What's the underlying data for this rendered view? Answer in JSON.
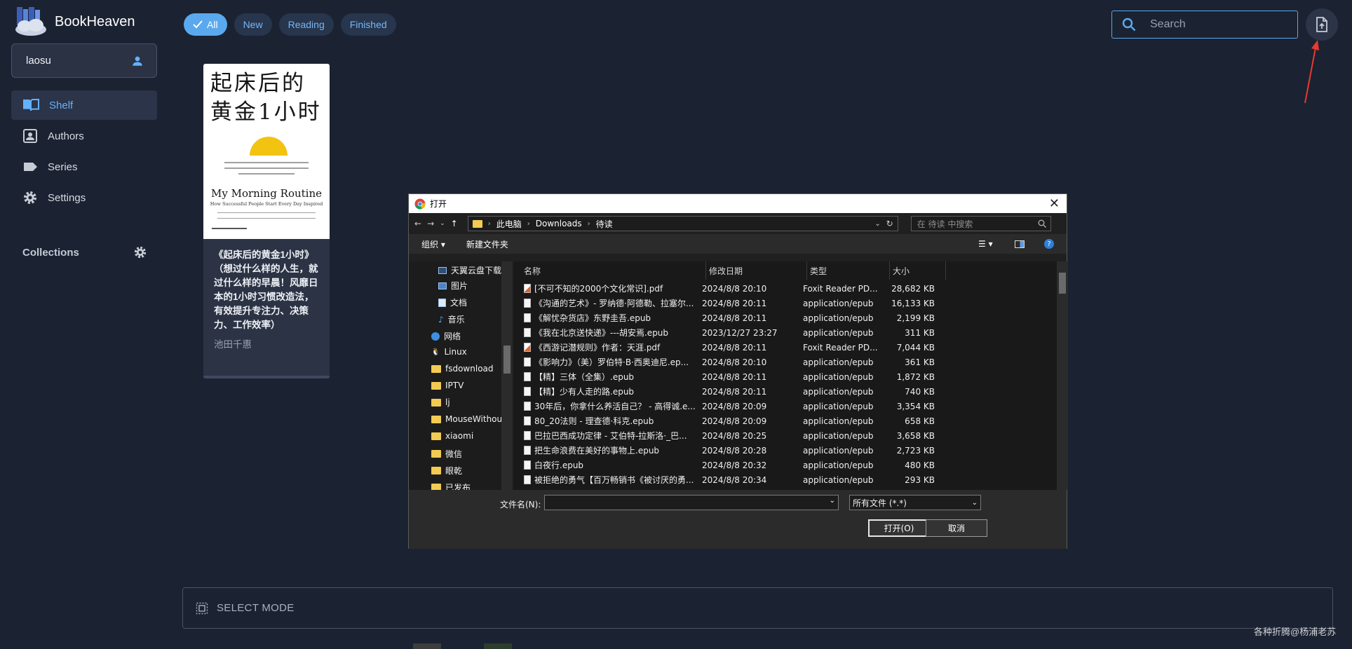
{
  "app": {
    "name": "BookHeaven",
    "user": "laosu",
    "nav": [
      {
        "label": "Shelf",
        "icon": "book-open-icon"
      },
      {
        "label": "Authors",
        "icon": "person-card-icon"
      },
      {
        "label": "Series",
        "icon": "tag-icon"
      },
      {
        "label": "Settings",
        "icon": "gear-icon"
      }
    ],
    "collections_label": "Collections",
    "filters": [
      "All",
      "New",
      "Reading",
      "Finished"
    ],
    "search_placeholder": "Search",
    "select_mode_label": "SELECT MODE",
    "watermark": "各种折腾@杨浦老苏",
    "accent": "#5aa9ee"
  },
  "book": {
    "cover_title": "起床后的黄金1小时",
    "cover_en": "My Morning Routine",
    "cover_en_sub": "How Successful People Start Every Day Inspired",
    "title": "《起床后的黄金1小时》（想过什么样的人生，就过什么样的早晨！风靡日本的1小时习惯改造法，有效提升专注力、决策力、工作效率）",
    "author": "池田千惠"
  },
  "dialog": {
    "title": "打开",
    "path": [
      "此电脑",
      "Downloads",
      "待读"
    ],
    "search_placeholder": "在 待读 中搜索",
    "toolbar": {
      "organize": "组织",
      "new_folder": "新建文件夹"
    },
    "tree": [
      "天翼云盘下载",
      "图片",
      "文档",
      "音乐",
      "网络",
      "Linux",
      "fsdownload",
      "IPTV",
      "lj",
      "MouseWithou",
      "xiaomi",
      "微信",
      "眼乾",
      "已发布"
    ],
    "columns": {
      "name": "名称",
      "date": "修改日期",
      "type": "类型",
      "size": "大小"
    },
    "files": [
      {
        "name": "[不可不知的2000个文化常识].pdf",
        "date": "2024/8/8 20:10",
        "type": "Foxit Reader PD...",
        "size": "28,682 KB",
        "pdf": true
      },
      {
        "name": "《沟通的艺术》- 罗纳德·阿德勒、拉塞尔...",
        "date": "2024/8/8 20:11",
        "type": "application/epub",
        "size": "16,133 KB"
      },
      {
        "name": "《解忧杂货店》东野圭吾.epub",
        "date": "2024/8/8 20:11",
        "type": "application/epub",
        "size": "2,199 KB"
      },
      {
        "name": "《我在北京送快递》---胡安焉.epub",
        "date": "2023/12/27 23:27",
        "type": "application/epub",
        "size": "311 KB"
      },
      {
        "name": "《西游记潜规则》作者：天涯.pdf",
        "date": "2024/8/8 20:11",
        "type": "Foxit Reader PD...",
        "size": "7,044 KB",
        "pdf": true
      },
      {
        "name": "《影响力》（美）罗伯特·B·西奥迪尼.ep...",
        "date": "2024/8/8 20:10",
        "type": "application/epub",
        "size": "361 KB"
      },
      {
        "name": "【精】三体（全集）.epub",
        "date": "2024/8/8 20:11",
        "type": "application/epub",
        "size": "1,872 KB"
      },
      {
        "name": "【精】少有人走的路.epub",
        "date": "2024/8/8 20:11",
        "type": "application/epub",
        "size": "740 KB"
      },
      {
        "name": "30年后，你拿什么养活自己？ - 高得诚.e...",
        "date": "2024/8/8 20:09",
        "type": "application/epub",
        "size": "3,354 KB"
      },
      {
        "name": "80_20法则 - 理查德·科克.epub",
        "date": "2024/8/8 20:09",
        "type": "application/epub",
        "size": "658 KB"
      },
      {
        "name": "巴拉巴西成功定律 - 艾伯特-拉斯洛·_巴...",
        "date": "2024/8/8 20:25",
        "type": "application/epub",
        "size": "3,658 KB"
      },
      {
        "name": "把生命浪费在美好的事物上.epub",
        "date": "2024/8/8 20:28",
        "type": "application/epub",
        "size": "2,723 KB"
      },
      {
        "name": "白夜行.epub",
        "date": "2024/8/8 20:32",
        "type": "application/epub",
        "size": "480 KB"
      },
      {
        "name": "被拒绝的勇气【百万畅销书《被讨厌的勇...",
        "date": "2024/8/8 20:34",
        "type": "application/epub",
        "size": "293 KB"
      }
    ],
    "filename_label": "文件名(N):",
    "filetype": "所有文件 (*.*)",
    "open_label": "打开(O)",
    "cancel_label": "取消"
  }
}
